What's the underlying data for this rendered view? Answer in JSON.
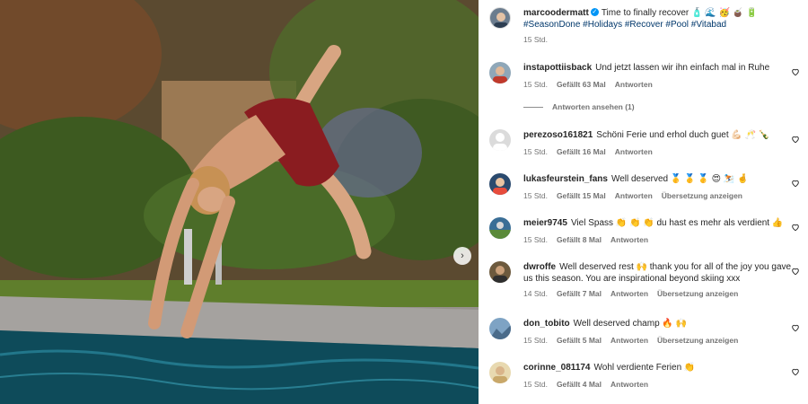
{
  "post": {
    "username": "marcoodermatt",
    "caption": "Time to finally recover 🧴 🌊 🥳 🧉 🔋",
    "hashtags": "#SeasonDone #Holidays #Recover #Pool #Vitabad",
    "time": "15 Std."
  },
  "view_replies": "Antworten ansehen (1)",
  "labels": {
    "reply": "Antworten",
    "translate": "Übersetzung anzeigen"
  },
  "comments": [
    {
      "username": "instapottiisback",
      "text": "Und jetzt lassen wir ihn einfach mal in Ruhe",
      "time": "15 Std.",
      "likes": "Gefällt 63 Mal"
    },
    {
      "username": "perezoso161821",
      "text": "Schöni Ferie und erhol duch guet 💪🏻 🥂 🍾",
      "time": "15 Std.",
      "likes": "Gefällt 16 Mal"
    },
    {
      "username": "lukasfeurstein_fans",
      "text": "Well deserved 🥇 🥇 🥇 😍 ⛷️ 🤞",
      "time": "15 Std.",
      "likes": "Gefällt 15 Mal"
    },
    {
      "username": "meier9745",
      "text": "Viel Spass 👏 👏 👏 du hast es mehr als verdient 👍",
      "time": "15 Std.",
      "likes": "Gefällt 8 Mal"
    },
    {
      "username": "dwroffe",
      "text": "Well deserved rest 🙌 thank you for all of the joy you gave us this season. You are inspirational beyond skiing xxx",
      "time": "14 Std.",
      "likes": "Gefällt 7 Mal"
    },
    {
      "username": "don_tobito",
      "text": "Well deserved champ 🔥 🙌",
      "time": "15 Std.",
      "likes": "Gefällt 5 Mal"
    },
    {
      "username": "corinne_081174",
      "text": "Wohl verdiente Ferien 👏",
      "time": "15 Std.",
      "likes": "Gefällt 4 Mal"
    }
  ],
  "colors": {
    "link": "#00376b",
    "muted": "#737373",
    "verified": "#0095f6"
  }
}
